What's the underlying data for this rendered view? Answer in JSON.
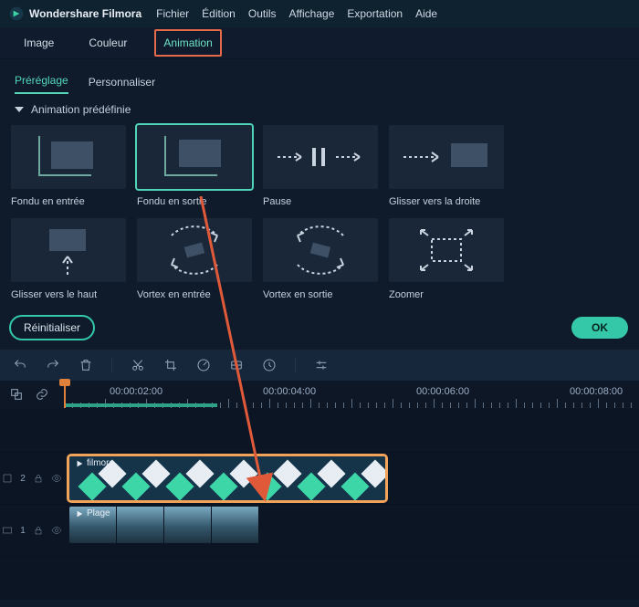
{
  "titlebar": {
    "brand": "Wondershare Filmora",
    "menu": [
      "Fichier",
      "Édition",
      "Outils",
      "Affichage",
      "Exportation",
      "Aide"
    ]
  },
  "prop_tabs": {
    "items": [
      "Image",
      "Couleur",
      "Animation"
    ],
    "active": "Animation"
  },
  "sub_tabs": {
    "items": [
      "Préréglage",
      "Personnaliser"
    ],
    "selected": "Préréglage"
  },
  "section": {
    "title": "Animation prédéfinie"
  },
  "presets": [
    {
      "label": "Fondu en entrée"
    },
    {
      "label": "Fondu en sortie"
    },
    {
      "label": "Pause"
    },
    {
      "label": "Glisser vers la droite"
    },
    {
      "label": "Glisser vers le haut"
    },
    {
      "label": "Vortex en entrée"
    },
    {
      "label": "Vortex en sortie"
    },
    {
      "label": "Zoomer"
    }
  ],
  "actions": {
    "reset": "Réinitialiser",
    "ok": "OK"
  },
  "toolbar_icons": [
    "undo",
    "redo",
    "delete",
    "cut",
    "crop",
    "speed",
    "color",
    "freeze",
    "adjust"
  ],
  "timeline": {
    "ticks": [
      "00:00:02:00",
      "00:00:04:00",
      "00:00:06:00",
      "00:00:08:00"
    ],
    "tracks": {
      "fx": {
        "id": "2",
        "clip_label": "filmora"
      },
      "video": {
        "id": "1",
        "clip_label": "Plage"
      }
    }
  }
}
